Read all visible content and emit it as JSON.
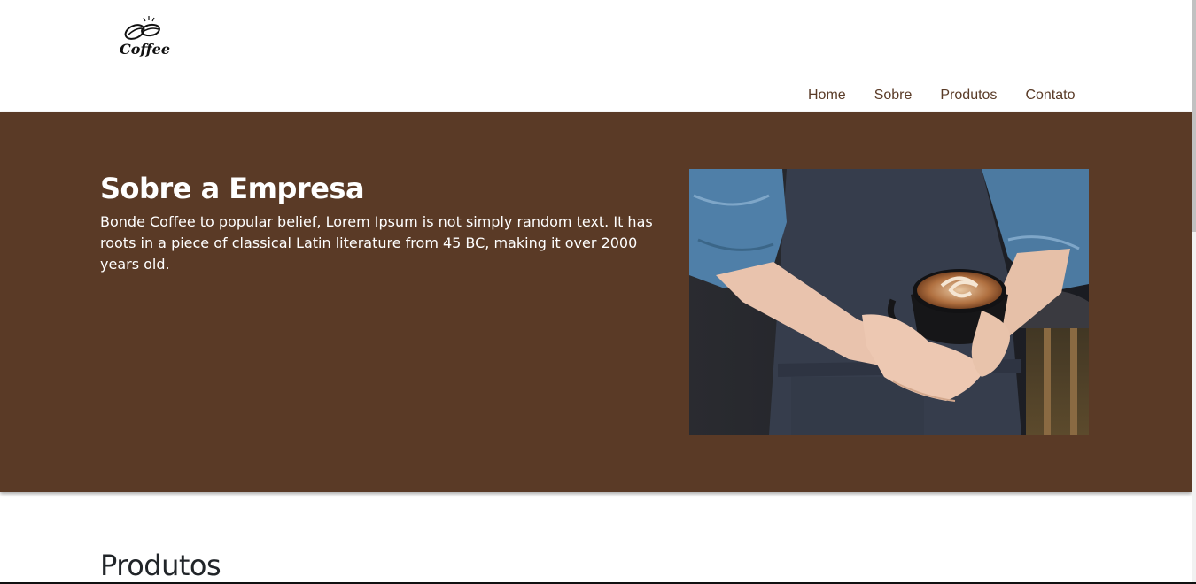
{
  "logo": {
    "text": "Coffee",
    "icon": "coffee-beans-icon"
  },
  "nav": {
    "items": [
      {
        "label": "Home"
      },
      {
        "label": "Sobre"
      },
      {
        "label": "Produtos"
      },
      {
        "label": "Contato"
      }
    ]
  },
  "about": {
    "title": "Sobre a Empresa",
    "text": "Bonde Coffee to popular belief, Lorem Ipsum is not simply random text. It has roots in a piece of classical Latin literature from 45 BC, making it over 2000 years old.",
    "photo": "barista-holding-latte-photo"
  },
  "produtos": {
    "title": "Produtos"
  },
  "colors": {
    "about_bg": "#5a3a26",
    "nav_link": "#5a3b27",
    "text_dark": "#212529"
  }
}
